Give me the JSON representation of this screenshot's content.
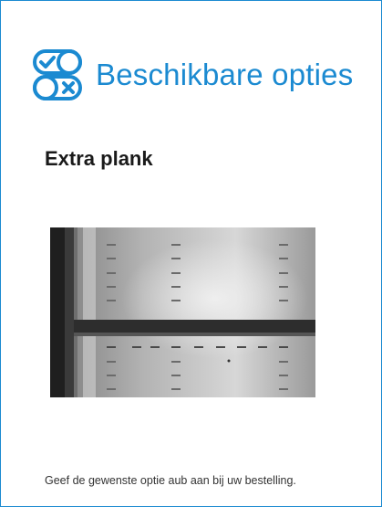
{
  "header": {
    "title": "Beschikbare opties",
    "icon": "toggle-options-icon",
    "accent": "#1b8ad1"
  },
  "option": {
    "title": "Extra plank",
    "image": "fridge-shelf-photo"
  },
  "footer": {
    "note": "Geef de gewenste optie aub aan bij uw bestelling."
  }
}
